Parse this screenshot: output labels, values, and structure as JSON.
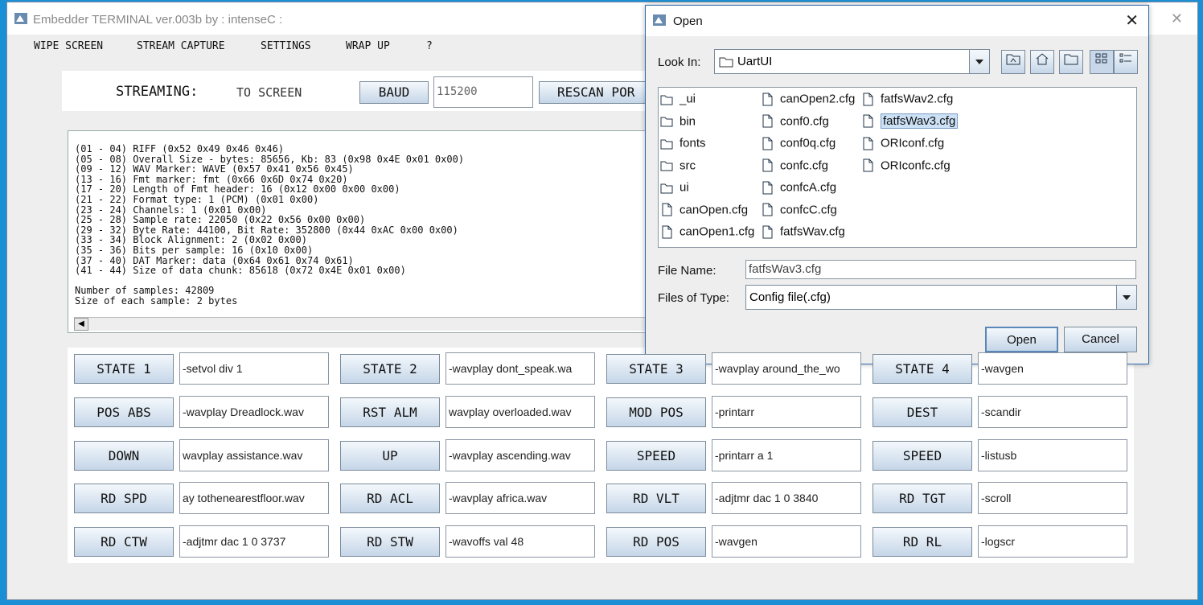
{
  "window": {
    "title": "Embedder TERMINAL ver.003b by : intenseC :",
    "close_glyph": "✕"
  },
  "menu": [
    "WIPE SCREEN",
    "STREAM CAPTURE",
    "SETTINGS",
    "WRAP UP",
    "?"
  ],
  "stream": {
    "label": "STREAMING:",
    "mode": "TO SCREEN",
    "baud_button": "BAUD",
    "baud_value": "115200",
    "rescan_button": "RESCAN POR"
  },
  "log": {
    "lines": [
      "(01 - 04) RIFF (0x52 0x49 0x46 0x46)",
      "(05 - 08) Overall Size - bytes: 85656, Kb: 83 (0x98 0x4E 0x01 0x00)",
      "(09 - 12) WAV Marker: WAVE (0x57 0x41 0x56 0x45)",
      "(13 - 16) Fmt marker: fmt (0x66 0x6D 0x74 0x20)",
      "(17 - 20) Length of Fmt header: 16 (0x12 0x00 0x00 0x00)",
      "(21 - 22) Format type: 1 (PCM) (0x01 0x00)",
      "(23 - 24) Channels: 1 (0x01 0x00)",
      "(25 - 28) Sample rate: 22050 (0x22 0x56 0x00 0x00)",
      "(29 - 32) Byte Rate: 44100, Bit Rate: 352800 (0x44 0xAC 0x00 0x00)",
      "(33 - 34) Block Alignment: 2 (0x02 0x00)",
      "(35 - 36) Bits per sample: 16 (0x10 0x00)",
      "(37 - 40) DAT Marker: data (0x64 0x61 0x74 0x61)",
      "(41 - 44) Size of data chunk: 85618 (0x72 0x4E 0x01 0x00)",
      "",
      "Number of samples: 42809",
      "Size of each sample: 2 bytes"
    ],
    "scroll_left": "◀"
  },
  "state_rows": [
    [
      {
        "button": "STATE 1",
        "command": "-setvol div 1"
      },
      {
        "button": "STATE 2",
        "command": "-wavplay dont_speak.wa"
      },
      {
        "button": "STATE 3",
        "command": "-wavplay around_the_wo"
      },
      {
        "button": "STATE 4",
        "command": "-wavgen"
      }
    ],
    [
      {
        "button": "POS ABS",
        "command": "-wavplay Dreadlock.wav"
      },
      {
        "button": "RST ALM",
        "command": "wavplay overloaded.wav"
      },
      {
        "button": "MOD POS",
        "command": "-printarr"
      },
      {
        "button": "DEST",
        "command": "-scandir"
      }
    ],
    [
      {
        "button": "DOWN",
        "command": "wavplay assistance.wav"
      },
      {
        "button": "UP",
        "command": "-wavplay ascending.wav"
      },
      {
        "button": "SPEED",
        "command": "-printarr a 1"
      },
      {
        "button": "SPEED",
        "command": "-listusb"
      }
    ],
    [
      {
        "button": "RD SPD",
        "command": "ay tothenearestfloor.wav"
      },
      {
        "button": "RD ACL",
        "command": "-wavplay africa.wav"
      },
      {
        "button": "RD VLT",
        "command": "-adjtmr dac 1 0 3840"
      },
      {
        "button": "RD TGT",
        "command": "-scroll"
      }
    ],
    [
      {
        "button": "RD CTW",
        "command": "-adjtmr dac 1 0 3737"
      },
      {
        "button": "RD STW",
        "command": "-wavoffs val 48"
      },
      {
        "button": "RD POS",
        "command": "-wavgen"
      },
      {
        "button": "RD RL",
        "command": "-logscr"
      }
    ]
  ],
  "dialog": {
    "title": "Open",
    "close_glyph": "✕",
    "look_in_label": "Look In:",
    "look_in_value": "UartUI",
    "toolbar_icons": [
      "up-folder-icon",
      "home-icon",
      "new-folder-icon",
      "list-view-icon",
      "details-view-icon"
    ],
    "files": [
      {
        "name": "_ui",
        "type": "folder",
        "col": 0,
        "row": 0
      },
      {
        "name": "bin",
        "type": "folder",
        "col": 0,
        "row": 1
      },
      {
        "name": "fonts",
        "type": "folder",
        "col": 0,
        "row": 2
      },
      {
        "name": "src",
        "type": "folder",
        "col": 0,
        "row": 3
      },
      {
        "name": "ui",
        "type": "folder",
        "col": 0,
        "row": 4
      },
      {
        "name": "canOpen.cfg",
        "type": "file",
        "col": 0,
        "row": 5
      },
      {
        "name": "canOpen1.cfg",
        "type": "file",
        "col": 0,
        "row": 6
      },
      {
        "name": "canOpen2.cfg",
        "type": "file",
        "col": 1,
        "row": 0
      },
      {
        "name": "conf0.cfg",
        "type": "file",
        "col": 1,
        "row": 1
      },
      {
        "name": "conf0q.cfg",
        "type": "file",
        "col": 1,
        "row": 2
      },
      {
        "name": "confc.cfg",
        "type": "file",
        "col": 1,
        "row": 3
      },
      {
        "name": "confcA.cfg",
        "type": "file",
        "col": 1,
        "row": 4
      },
      {
        "name": "confcC.cfg",
        "type": "file",
        "col": 1,
        "row": 5
      },
      {
        "name": "fatfsWav.cfg",
        "type": "file",
        "col": 1,
        "row": 6
      },
      {
        "name": "fatfsWav2.cfg",
        "type": "file",
        "col": 2,
        "row": 0
      },
      {
        "name": "fatfsWav3.cfg",
        "type": "file",
        "col": 2,
        "row": 1,
        "selected": true
      },
      {
        "name": "ORIconf.cfg",
        "type": "file",
        "col": 2,
        "row": 2
      },
      {
        "name": "ORIconfc.cfg",
        "type": "file",
        "col": 2,
        "row": 3
      }
    ],
    "file_name_label": "File Name:",
    "file_name_value": "fatfsWav3.cfg",
    "files_of_type_label": "Files of Type:",
    "files_of_type_value": "Config file(.cfg)",
    "open_button": "Open",
    "cancel_button": "Cancel"
  },
  "colors": {
    "desktop": "#1b8fd6",
    "button_top": "#f4f8fc",
    "button_bottom": "#c5d6e8",
    "selection": "#cce1f5"
  }
}
